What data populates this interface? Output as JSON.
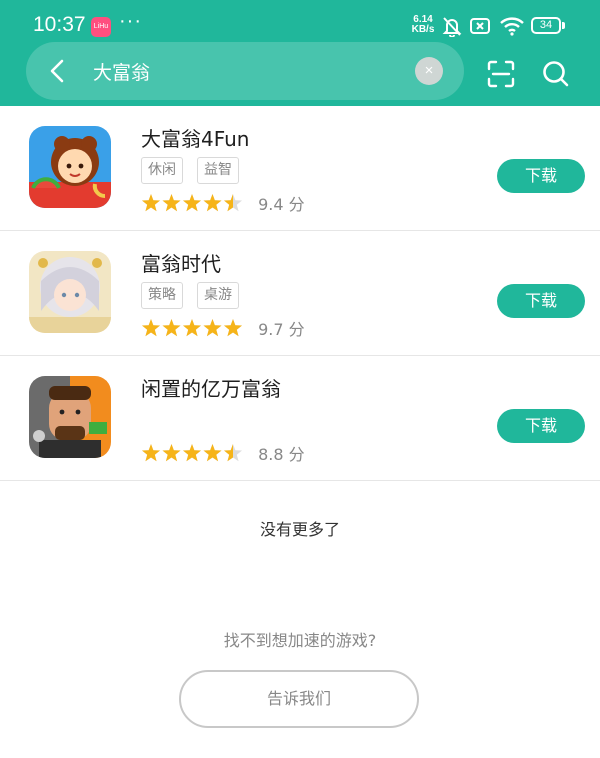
{
  "status_bar": {
    "time": "10:37",
    "app_badge": "LiHu",
    "more_dots": "···",
    "net_speed_value": "6.14",
    "net_speed_unit": "KB/s",
    "battery": "34"
  },
  "search": {
    "query": "大富翁",
    "clear_symbol": "×"
  },
  "results": [
    {
      "name": "大富翁4Fun",
      "tags": [
        "休闲",
        "益智"
      ],
      "rating": 4.5,
      "score_text": "9.4 分",
      "download_label": "下载",
      "icon": "cartoon-girl-icon"
    },
    {
      "name": "富翁时代",
      "tags": [
        "策略",
        "桌游"
      ],
      "rating": 5,
      "score_text": "9.7 分",
      "download_label": "下载",
      "icon": "anime-character-icon"
    },
    {
      "name": "闲置的亿万富翁",
      "tags": [],
      "rating": 4.5,
      "score_text": "8.8 分",
      "download_label": "下载",
      "icon": "rich-man-icon"
    }
  ],
  "footer": {
    "no_more": "没有更多了",
    "question": "找不到想加速的游戏?",
    "tell_us": "告诉我们"
  },
  "colors": {
    "accent": "#20b79b",
    "star": "#f6b419",
    "star_empty": "#dddddd"
  }
}
